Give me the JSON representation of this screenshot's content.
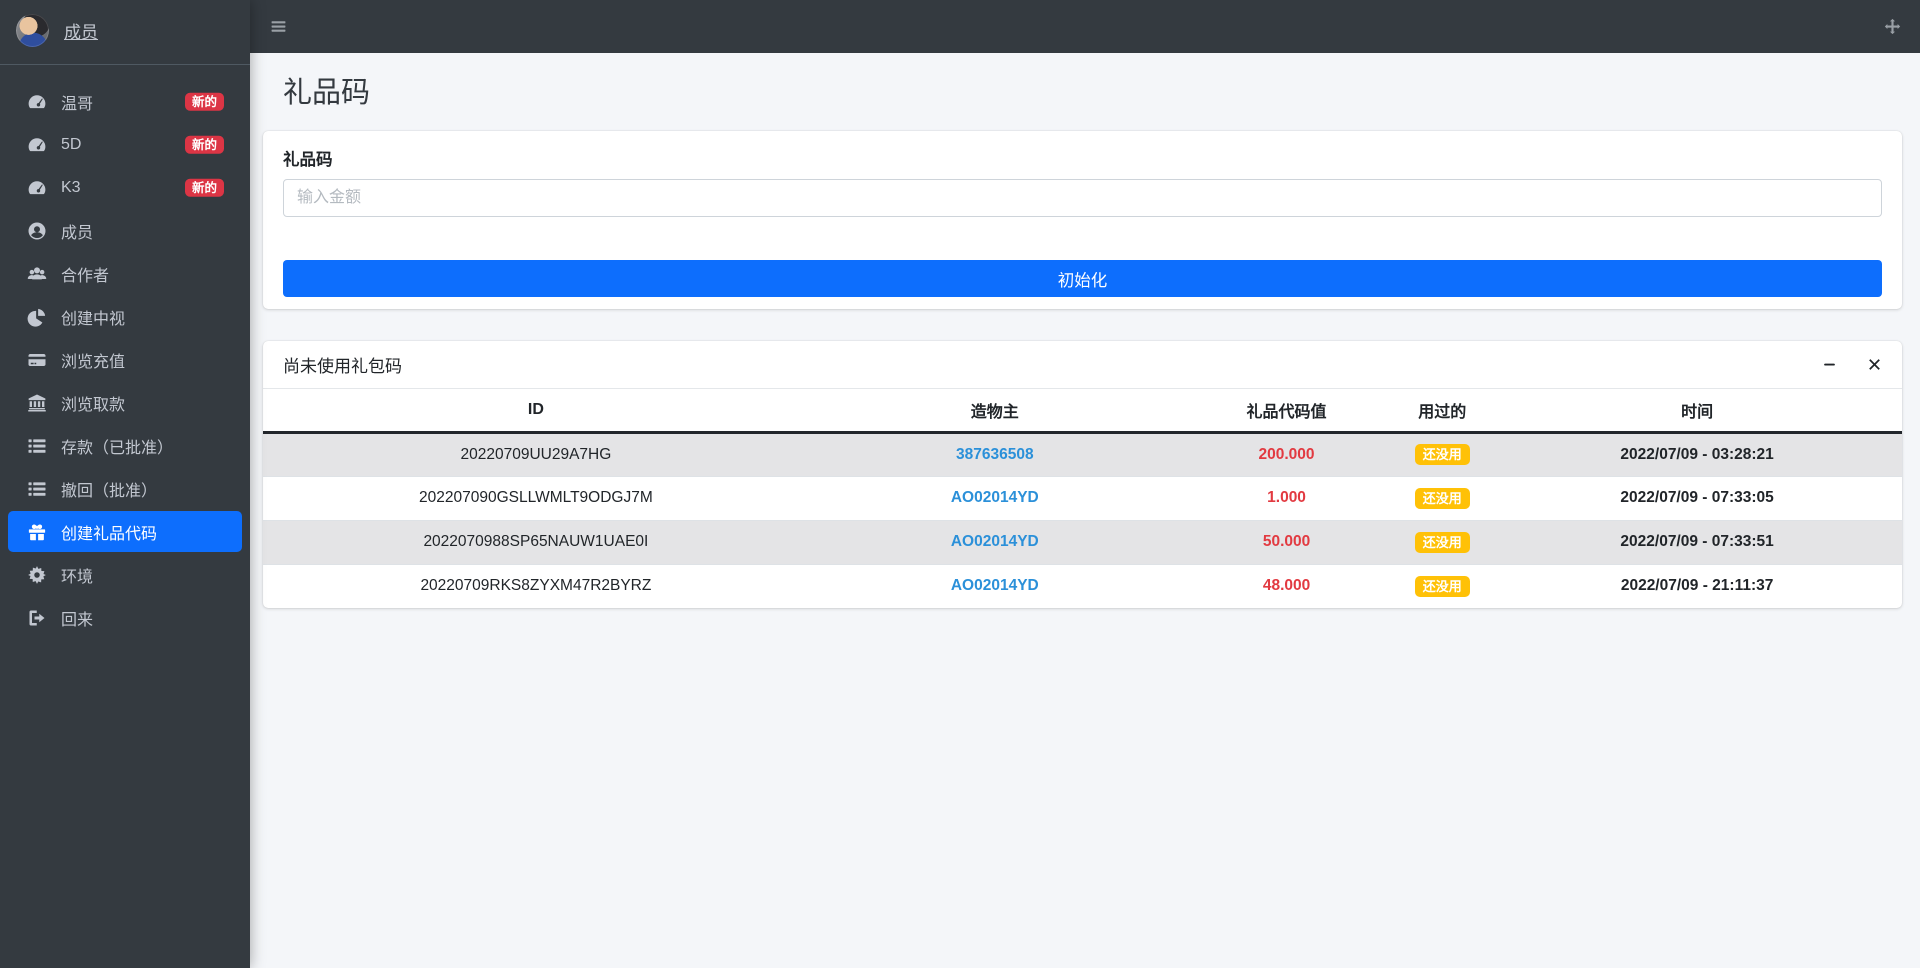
{
  "colors": {
    "sidebar_bg": "#343a40",
    "accent_blue": "#0d6efd",
    "badge_new_red": "#dc3545",
    "unused_badge_yellow": "#ffc107",
    "value_red": "#e23a41",
    "creator_link_blue": "#2b90d9",
    "content_bg": "#f4f6f9"
  },
  "sidebar": {
    "user": {
      "name": "成员"
    },
    "items": [
      {
        "label": "温哥",
        "icon": "speedometer-icon",
        "badge": "新的"
      },
      {
        "label": "5D",
        "icon": "speedometer-icon",
        "badge": "新的"
      },
      {
        "label": "K3",
        "icon": "speedometer-icon",
        "badge": "新的"
      },
      {
        "label": "成员",
        "icon": "user-circle-icon"
      },
      {
        "label": "合作者",
        "icon": "users-icon"
      },
      {
        "label": "创建中视",
        "icon": "pie-chart-icon"
      },
      {
        "label": "浏览充值",
        "icon": "credit-card-icon"
      },
      {
        "label": "浏览取款",
        "icon": "bank-icon"
      },
      {
        "label": "存款（已批准）",
        "icon": "list-icon"
      },
      {
        "label": "撤回（批准）",
        "icon": "list-icon"
      },
      {
        "label": "创建礼品代码",
        "icon": "gift-icon",
        "active": true
      },
      {
        "label": "环境",
        "icon": "gear-icon"
      },
      {
        "label": "回来",
        "icon": "sign-out-icon"
      }
    ]
  },
  "page": {
    "title": "礼品码"
  },
  "gift_form": {
    "card_label": "礼品码",
    "input_placeholder": "输入金额",
    "submit_label": "初始化"
  },
  "unused_codes": {
    "title": "尚未使用礼包码",
    "columns": [
      "ID",
      "造物主",
      "礼品代码值",
      "用过的",
      "时间"
    ],
    "rows": [
      {
        "id": "20220709UU29A7HG",
        "creator": "387636508",
        "value": "200.000",
        "used": "还没用",
        "time": "2022/07/09 - 03:28:21"
      },
      {
        "id": "202207090GSLLWMLT9ODGJ7M",
        "creator": "AO02014YD",
        "value": "1.000",
        "used": "还没用",
        "time": "2022/07/09 - 07:33:05"
      },
      {
        "id": "2022070988SP65NAUW1UAE0I",
        "creator": "AO02014YD",
        "value": "50.000",
        "used": "还没用",
        "time": "2022/07/09 - 07:33:51"
      },
      {
        "id": "20220709RKS8ZYXM47R2BYRZ",
        "creator": "AO02014YD",
        "value": "48.000",
        "used": "还没用",
        "time": "2022/07/09 - 21:11:37"
      }
    ]
  }
}
